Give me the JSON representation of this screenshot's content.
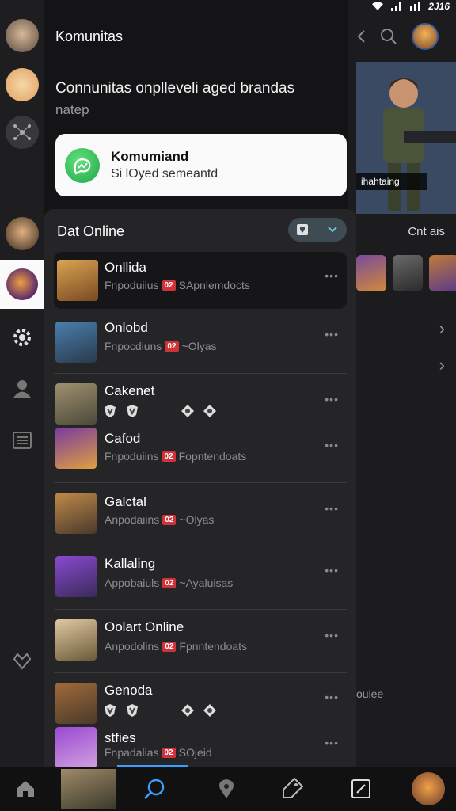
{
  "status": {
    "time": "2J16"
  },
  "top": {
    "title": "Komunitas",
    "subtitle": "Connunitas onplleveli aged brandas",
    "subtitle2": "natep"
  },
  "notification": {
    "title": "Komumiand",
    "text": "Si lOyed semeantd"
  },
  "background": {
    "hero_caption": "ihahtaing",
    "section_label": "Cnt ais",
    "more": "ouiee"
  },
  "panel": {
    "title": "Dat Online",
    "rows": [
      {
        "name": "Onllida",
        "meta_left": "Fnpoduiius",
        "badge": "02",
        "meta_right": "SApnlemdocts"
      },
      {
        "name": "Onlobd",
        "meta_left": "Fnpocdiuns",
        "badge": "02",
        "meta_right": "~Olyas"
      },
      {
        "name": "Cakenet",
        "meta_left": "",
        "badge": "",
        "meta_right": ""
      },
      {
        "name": "Cafod",
        "meta_left": "Fnpoduiins",
        "badge": "02",
        "meta_right": "Fopntendoats"
      },
      {
        "name": "Galctal",
        "meta_left": "Anpodaiins",
        "badge": "02",
        "meta_right": "~Olyas"
      },
      {
        "name": "Kallaling",
        "meta_left": "Appobaiuls",
        "badge": "02",
        "meta_right": "~Ayaluisas"
      },
      {
        "name": "Oolart Online",
        "meta_left": "Anpodolins",
        "badge": "02",
        "meta_right": "Fpnntendoats"
      },
      {
        "name": "Genoda",
        "meta_left": "",
        "badge": "",
        "meta_right": ""
      },
      {
        "name": "stfies",
        "meta_left": "Fnpadalias",
        "badge": "02",
        "meta_right": "SOjeid"
      }
    ]
  },
  "colors": {
    "background": "#141416",
    "panel": "#252528",
    "accent": "#3aa0ff",
    "badge": "#d0323a",
    "notification_icon": "#1ea64a"
  }
}
